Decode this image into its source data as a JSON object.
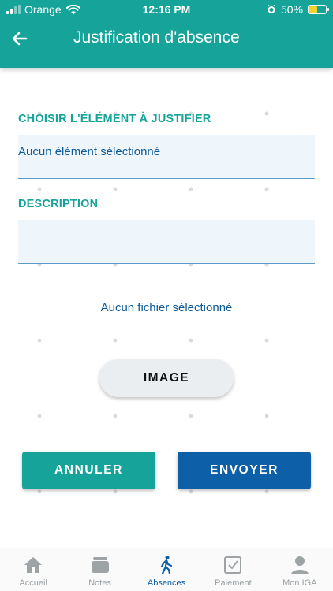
{
  "status_bar": {
    "carrier": "Orange",
    "time": "12:16 PM",
    "battery": "50%",
    "battery_level": 0.5
  },
  "header": {
    "title": "Justification d'absence",
    "back_icon": "arrow-left-icon"
  },
  "form": {
    "element_label": "CHOISIR L'ÉLÉMENT À JUSTIFIER",
    "element_value": "Aucun élément sélectionné",
    "description_label": "DESCRIPTION",
    "description_value": "",
    "file_status": "Aucun fichier sélectionné",
    "image_button": "IMAGE",
    "cancel_button": "ANNULER",
    "send_button": "ENVOYER"
  },
  "tabbar": {
    "items": [
      {
        "label": "Accueil",
        "icon": "home-icon",
        "active": false
      },
      {
        "label": "Notes",
        "icon": "notes-icon",
        "active": false
      },
      {
        "label": "Absences",
        "icon": "walking-person-icon",
        "active": true
      },
      {
        "label": "Paiement",
        "icon": "checkbox-icon",
        "active": false
      },
      {
        "label": "Mon IGA",
        "icon": "person-icon",
        "active": false
      }
    ]
  },
  "colors": {
    "primary_teal": "#16a39a",
    "primary_blue": "#0d5fa7",
    "field_bg": "#eef6fc"
  }
}
